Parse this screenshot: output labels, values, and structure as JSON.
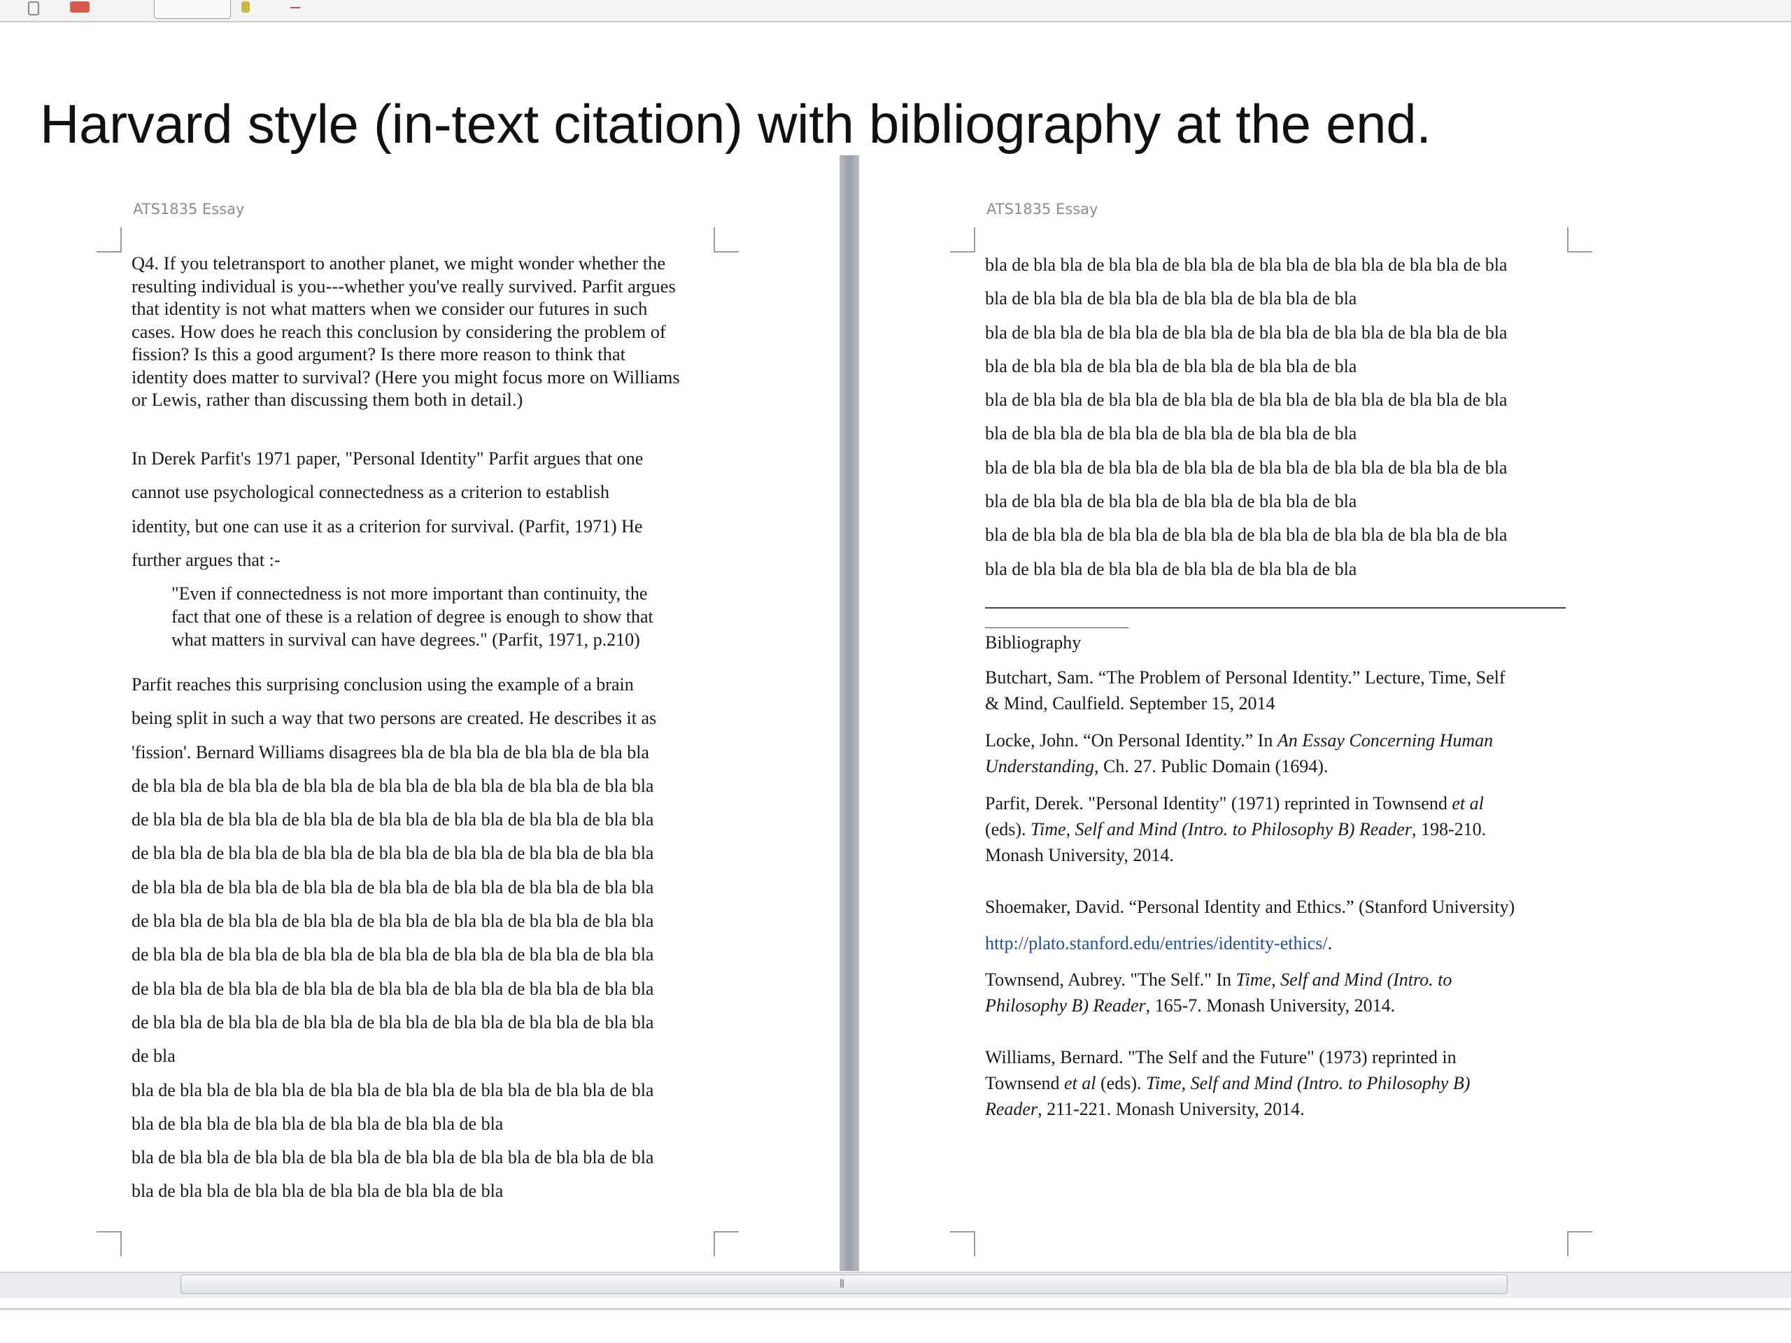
{
  "headline": "Harvard style (in-text citation) with bibliography at the end.",
  "left_page": {
    "header": "ATS1835 Essay",
    "question_lines": [
      "Q4. If you teletransport to another planet, we might wonder whether the",
      "resulting individual is you---whether you've really survived. Parfit argues",
      "that identity is not what matters when we consider our futures in such",
      "cases.  How does he reach this conclusion by considering the problem of",
      "fission? Is this a good argument? Is there more reason to think that",
      "identity does matter to survival? (Here you might focus more on Williams",
      "or Lewis, rather than discussing  them both in detail.)"
    ],
    "paragraph1_lines": [
      "In Derek Parfit's 1971 paper, \"Personal Identity\" Parfit argues that one",
      "cannot use psychological connectedness  as a criterion to establish",
      "identity, but one can use it as a criterion for survival. (Parfit, 1971) He",
      "further argues that :-"
    ],
    "quote_lines": [
      "\"Even if connectedness is not more important than continuity, the",
      "fact that one of these is a relation of degree is enough to show that",
      "what matters in survival can have degrees.\" (Parfit, 1971, p.210)"
    ],
    "paragraph2_lines": [
      "Parfit reaches this surprising conclusion using the example of a brain",
      "being split in such a way that two persons are created. He describes it as",
      "'fission'.  Bernard Williams disagrees bla de bla bla de bla bla de bla bla",
      "de bla bla de bla bla de bla bla de bla bla de bla bla de bla bla de bla bla",
      "de bla bla de bla bla de bla bla de bla bla de bla bla de bla bla de bla bla",
      "de bla bla de bla bla de bla bla de bla bla de bla bla de bla bla de bla bla",
      "de bla bla de bla bla de bla bla de bla bla de bla bla de bla bla de bla bla",
      "de bla bla de bla bla de bla bla de bla bla de bla bla de bla bla de bla bla",
      "de bla bla de bla bla de bla bla de bla bla de bla bla de bla bla de bla bla",
      "de bla bla de bla bla de bla bla de bla bla de bla bla de bla bla de bla bla",
      "de bla bla de bla bla de bla bla de bla bla de bla bla de bla bla de bla bla",
      "de bla",
      " bla de bla bla de bla bla de bla bla de bla bla de bla bla de bla bla de bla",
      "bla de bla bla de bla bla de bla bla de bla bla de bla",
      "bla de bla bla de bla bla de bla bla de bla bla de bla bla de bla bla de bla",
      "bla de bla bla de bla bla de bla bla de bla bla de bla"
    ]
  },
  "right_page": {
    "header": "ATS1835 Essay",
    "filler_lines": [
      "bla de bla bla de bla bla de bla bla de bla bla de bla bla de bla bla de bla",
      "bla de bla bla de bla bla de bla bla de bla bla de bla",
      "bla de bla bla de bla bla de bla bla de bla bla de bla bla de bla bla de bla",
      "bla de bla bla de bla bla de bla bla de bla bla de bla",
      "bla de bla bla de bla bla de bla bla de bla bla de bla bla de bla bla de bla",
      "bla de bla bla de bla bla de bla bla de bla bla de bla",
      "bla de bla bla de bla bla de bla bla de bla bla de bla bla de bla bla de bla",
      "bla de bla bla de bla bla de bla bla de bla bla de bla",
      "bla de bla bla de bla bla de bla bla de bla bla de bla bla de bla bla de bla",
      "bla de bla bla de bla bla de bla bla de bla bla de bla"
    ],
    "bibliography_title": "Bibliography",
    "entries": {
      "butchart": [
        "Butchart, Sam. “The Problem of Personal Identity.” Lecture, Time, Self",
        "& Mind, Caulfield. September 15, 2014"
      ],
      "locke": {
        "line1_a": "Locke, John. “On Personal Identity.” In ",
        "line1_b": "An Essay Concerning Human",
        "line2_a": "Understanding",
        "line2_b": ", Ch. 27. Public Domain (1694)."
      },
      "parfit": {
        "line1_a": "Parfit, Derek. \"Personal Identity\" (1971) reprinted in Townsend ",
        "line1_b": "et al",
        "line2_a": "(eds). ",
        "line2_b": "Time, Self and Mind (Intro. to Philosophy B) Reader",
        "line2_c": ", 198-210.",
        "line3": "Monash University, 2014."
      },
      "shoemaker": {
        "line1": "Shoemaker, David. “Personal Identity and Ethics.” (Stanford University)",
        "link": "http://plato.stanford.edu/entries/identity-ethics/",
        "link_end": "."
      },
      "townsend": {
        "line1_a": "Townsend, Aubrey. \"The Self.\" In ",
        "line1_b": "Time, Self and Mind (Intro. to",
        "line2_a": "Philosophy B) Reader",
        "line2_b": ", 165-7. Monash University, 2014."
      },
      "williams": {
        "line1": "Williams, Bernard. \"The Self and the Future\" (1973) reprinted in",
        "line2_a": "Townsend ",
        "line2_b": "et al",
        "line2_c": " (eds). ",
        "line2_d": "Time, Self and Mind (Intro. to Philosophy B)",
        "line3_a": "Reader",
        "line3_b": ", 211-221. Monash University, 2014."
      }
    }
  }
}
